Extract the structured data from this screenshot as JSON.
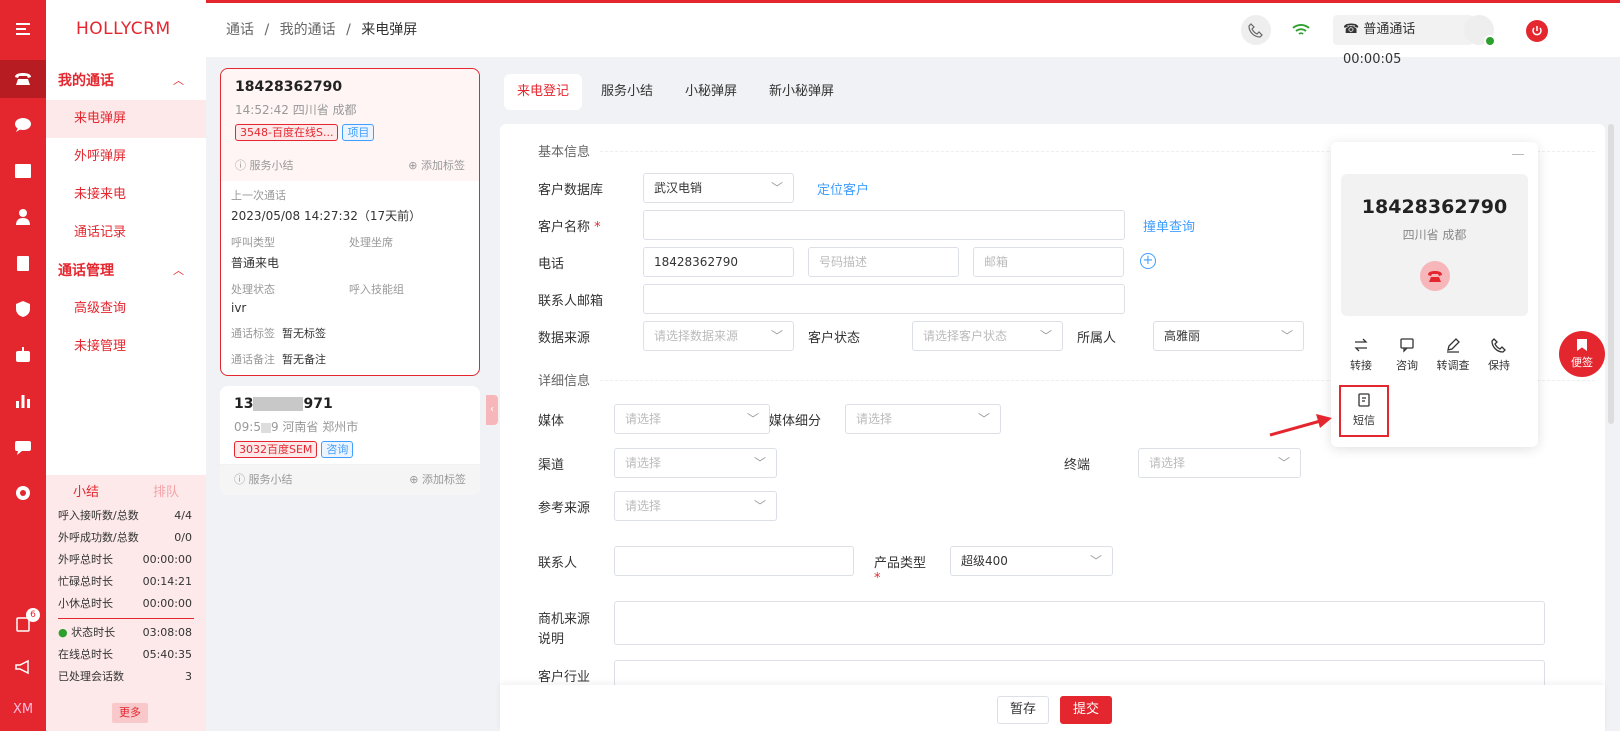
{
  "app": {
    "logo": "HOLLYCRM"
  },
  "breadcrumb": {
    "a": "通话",
    "sep1": "/",
    "b": "我的通话",
    "sep2": "/",
    "c": "来电弹屏"
  },
  "topbar": {
    "call_status": "普通通话 00:00:05"
  },
  "sidebar": {
    "group1": "我的通话",
    "items1": [
      "来电弹屏",
      "外呼弹屏",
      "未接来电",
      "通话记录"
    ],
    "group2": "通话管理",
    "items2": [
      "高级查询",
      "未接管理"
    ]
  },
  "iconbar": {
    "badge": "6",
    "bottom": "XM"
  },
  "stats": {
    "tab_a": "小结",
    "tab_b": "排队",
    "rows": [
      {
        "k": "呼入接听数/总数",
        "v": "4/4"
      },
      {
        "k": "外呼成功数/总数",
        "v": "0/0"
      },
      {
        "k": "外呼总时长",
        "v": "00:00:00"
      },
      {
        "k": "忙碌总时长",
        "v": "00:14:21"
      },
      {
        "k": "小休总时长",
        "v": "00:00:00"
      }
    ],
    "rows2": [
      {
        "k": "状态时长",
        "v": "03:08:08"
      },
      {
        "k": "在线总时长",
        "v": "05:40:35"
      },
      {
        "k": "已处理会话数",
        "v": "3"
      }
    ],
    "more": "更多"
  },
  "calls": [
    {
      "number": "18428362790",
      "meta": "14:52:42 四川省 成都",
      "tag1": "3548-百度在线S...",
      "tag2": "项目",
      "summary": "服务小结",
      "add_tag": "添加标签",
      "last_call_label": "上一次通话",
      "last_call": "2023/05/08 14:27:32（17天前）",
      "call_type_label": "呼叫类型",
      "agent_label": "处理坐席",
      "call_type": "普通来电",
      "status_label": "处理状态",
      "skill_label": "呼入技能组",
      "status": "ivr",
      "tag_label": "通话标签",
      "tag_value": "暂无标签",
      "note_label": "通话备注",
      "note_value": "暂无备注"
    },
    {
      "number_a": "13",
      "number_b": "971",
      "meta_a": "09:5",
      "meta_b": "9 河南省 郑州市",
      "tag1": "3032百度SEM",
      "tag2": "咨询",
      "summary": "服务小结",
      "add_tag": "添加标签"
    }
  ],
  "tabs": [
    "来电登记",
    "服务小结",
    "小秘弹屏",
    "新小秘弹屏"
  ],
  "form": {
    "sect_basic": "基本信息",
    "db_label": "客户数据库",
    "db_value": "武汉电销",
    "locate": "定位客户",
    "name_label": "客户名称",
    "req": "*",
    "dup_query": "撞单查询",
    "phone_label": "电话",
    "phone_value": "18428362790",
    "phone_desc_ph": "号码描述",
    "mail_ph": "邮箱",
    "contact_email_label": "联系人邮箱",
    "source_label": "数据来源",
    "source_ph": "请选择数据来源",
    "cust_status_label": "客户状态",
    "cust_status_ph": "请选择客户状态",
    "owner_label": "所属人",
    "owner_value": "高雅丽",
    "sect_detail": "详细信息",
    "media_label": "媒体",
    "select_ph": "请选择",
    "media_sub_label": "媒体细分",
    "channel_label": "渠道",
    "terminal_label": "终端",
    "ref_source_label": "参考来源",
    "contact_label": "联系人",
    "product_label": "产品类型",
    "product_value": "超级400",
    "opp_label_1": "商机来源",
    "opp_label_2": "说明",
    "industry_label": "客户行业"
  },
  "footer": {
    "save": "暂存",
    "submit": "提交"
  },
  "popup": {
    "number": "18428362790",
    "location": "四川省 成都",
    "actions": [
      "转接",
      "咨询",
      "转调查",
      "保持"
    ],
    "sms": "短信"
  },
  "float_btn": "便签",
  "colors": {
    "brand": "#e4272f",
    "link": "#409eff"
  }
}
